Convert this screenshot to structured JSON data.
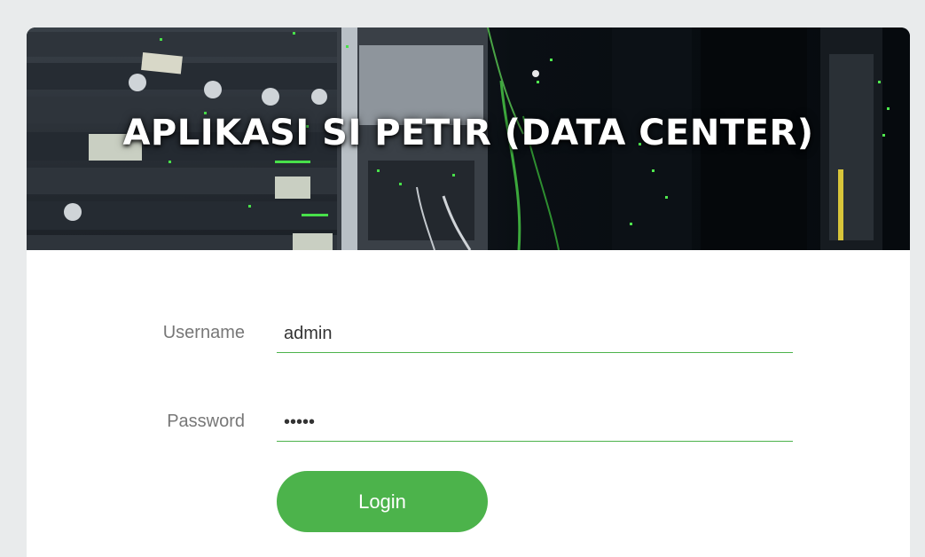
{
  "header": {
    "title": "APLIKASI SI PETIR (DATA CENTER)"
  },
  "form": {
    "username": {
      "label": "Username",
      "value": "admin"
    },
    "password": {
      "label": "Password",
      "value": "•••••"
    },
    "login_label": "Login"
  },
  "colors": {
    "page_background": "#e9ebec",
    "card_background": "#ffffff",
    "accent": "#4cb34b",
    "label_text": "#777777"
  },
  "icons": {
    "hero_image": "server-rack-data-center-photo"
  }
}
